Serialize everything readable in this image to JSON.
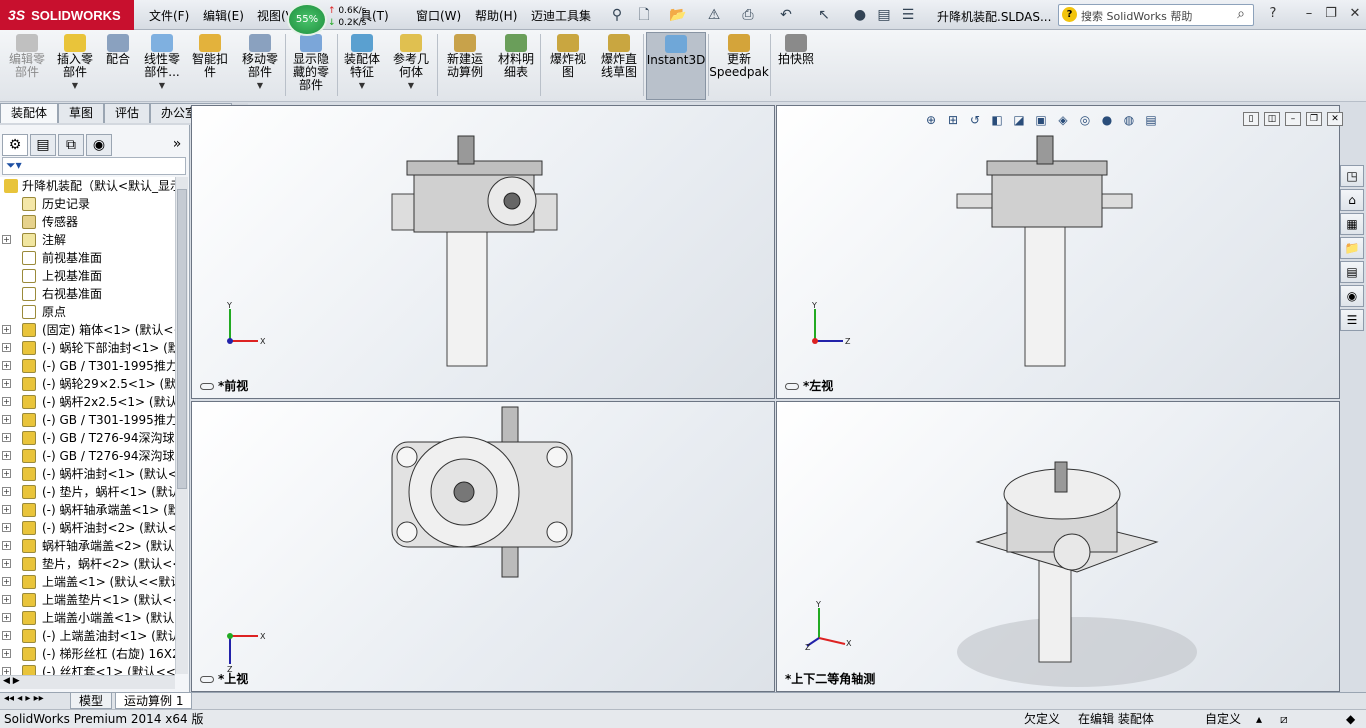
{
  "brand": {
    "logo_text": "SOLIDWORKS",
    "ds_mark": "3S",
    "color": "#c8102e"
  },
  "menu": [
    "文件(F)",
    "编辑(E)",
    "视图(V)",
    "具(T)",
    "窗口(W)",
    "帮助(H)",
    "迈迪工具集"
  ],
  "network": {
    "percent": "55%",
    "up": "0.6K/s",
    "down": "0.2K/s"
  },
  "document_title": "升降机装配.SLDAS...",
  "help_search": {
    "placeholder": "搜索 SolidWorks 帮助"
  },
  "command_manager": [
    {
      "label": "编辑零\n部件",
      "disabled": true,
      "icon": "edit-component-icon"
    },
    {
      "label": "插入零\n部件",
      "dropdown": true,
      "icon": "insert-component-icon"
    },
    {
      "label": "配合",
      "icon": "mate-icon"
    },
    {
      "label": "线性零\n部件...",
      "dropdown": true,
      "icon": "linear-pattern-icon"
    },
    {
      "label": "智能扣\n件",
      "icon": "smart-fastener-icon"
    },
    {
      "label": "移动零\n部件",
      "dropdown": true,
      "icon": "move-component-icon"
    },
    {
      "label": "显示隐\n藏的零\n部件",
      "icon": "show-hidden-icon"
    },
    {
      "label": "装配体\n特征",
      "dropdown": true,
      "icon": "assembly-feature-icon"
    },
    {
      "label": "参考几\n何体",
      "dropdown": true,
      "icon": "reference-geometry-icon"
    },
    {
      "label": "新建运\n动算例",
      "icon": "new-motion-study-icon"
    },
    {
      "label": "材料明\n细表",
      "icon": "bom-icon"
    },
    {
      "label": "爆炸视\n图",
      "icon": "exploded-view-icon"
    },
    {
      "label": "爆炸直\n线草图",
      "icon": "explode-line-sketch-icon"
    },
    {
      "label": "Instant3D",
      "active": true,
      "icon": "instant3d-icon"
    },
    {
      "label": "更新\nSpeedpak",
      "icon": "speedpak-icon"
    },
    {
      "label": "拍快照",
      "icon": "snapshot-icon"
    }
  ],
  "command_tabs": [
    "装配体",
    "草图",
    "评估",
    "办公室产品"
  ],
  "feature_tree": {
    "root": "升降机装配（默认<默认_显示",
    "items": [
      {
        "label": "历史记录",
        "icon": "history-icon"
      },
      {
        "label": "传感器",
        "icon": "sensor-icon"
      },
      {
        "label": "注解",
        "icon": "annotation-icon",
        "expand": true
      },
      {
        "label": "前视基准面",
        "icon": "plane-icon"
      },
      {
        "label": "上视基准面",
        "icon": "plane-icon"
      },
      {
        "label": "右视基准面",
        "icon": "plane-icon"
      },
      {
        "label": "原点",
        "icon": "origin-icon"
      },
      {
        "label": "(固定) 箱体<1> (默认<<",
        "icon": "part-icon",
        "expand": true
      },
      {
        "label": "(-) 蜗轮下部油封<1> (默",
        "icon": "part-icon",
        "expand": true
      },
      {
        "label": "(-) GB / T301-1995推力",
        "icon": "part-icon",
        "expand": true
      },
      {
        "label": "(-) 蜗轮29×2.5<1> (默认",
        "icon": "part-icon",
        "expand": true
      },
      {
        "label": "(-) 蜗杆2x2.5<1> (默认<",
        "icon": "part-icon",
        "expand": true
      },
      {
        "label": "(-) GB / T301-1995推力",
        "icon": "part-icon",
        "expand": true
      },
      {
        "label": "(-) GB / T276-94深沟球",
        "icon": "part-icon",
        "expand": true
      },
      {
        "label": "(-) GB / T276-94深沟球",
        "icon": "part-icon",
        "expand": true
      },
      {
        "label": "(-) 蜗杆油封<1> (默认<",
        "icon": "part-icon",
        "expand": true
      },
      {
        "label": "(-) 垫片，蜗杆<1> (默认",
        "icon": "part-icon",
        "expand": true
      },
      {
        "label": "(-) 蜗杆轴承端盖<1> (默",
        "icon": "part-icon",
        "expand": true
      },
      {
        "label": "(-) 蜗杆油封<2> (默认<",
        "icon": "part-icon",
        "expand": true
      },
      {
        "label": "蜗杆轴承端盖<2> (默认",
        "icon": "part-icon",
        "expand": true
      },
      {
        "label": "垫片，蜗杆<2> (默认<<",
        "icon": "part-icon",
        "expand": true
      },
      {
        "label": "上端盖<1> (默认<<默认",
        "icon": "part-icon",
        "expand": true
      },
      {
        "label": "上端盖垫片<1> (默认<<",
        "icon": "part-icon",
        "expand": true
      },
      {
        "label": "上端盖小端盖<1> (默认<",
        "icon": "part-icon",
        "expand": true
      },
      {
        "label": "(-) 上端盖油封<1> (默认",
        "icon": "part-icon",
        "expand": true
      },
      {
        "label": "(-) 梯形丝杠 (右旋) 16X2",
        "icon": "part-icon",
        "expand": true
      },
      {
        "label": "(-) 丝杠套<1> (默认<<",
        "icon": "part-icon",
        "expand": true
      }
    ]
  },
  "viewports": [
    {
      "name": "*前视",
      "axes": [
        "Y",
        "X"
      ]
    },
    {
      "name": "*左视",
      "axes": [
        "Y",
        "Z"
      ]
    },
    {
      "name": "*上视",
      "axes": [
        "X",
        "Z"
      ]
    },
    {
      "name": "*上下二等角轴测",
      "axes": [
        "Y",
        "X",
        "Z"
      ]
    }
  ],
  "bottom_tabs": [
    "模型",
    "运动算例 1"
  ],
  "status": {
    "product": "SolidWorks Premium 2014 x64 版",
    "definition": "欠定义",
    "editing": "在编辑 装配体",
    "custom": "自定义"
  }
}
